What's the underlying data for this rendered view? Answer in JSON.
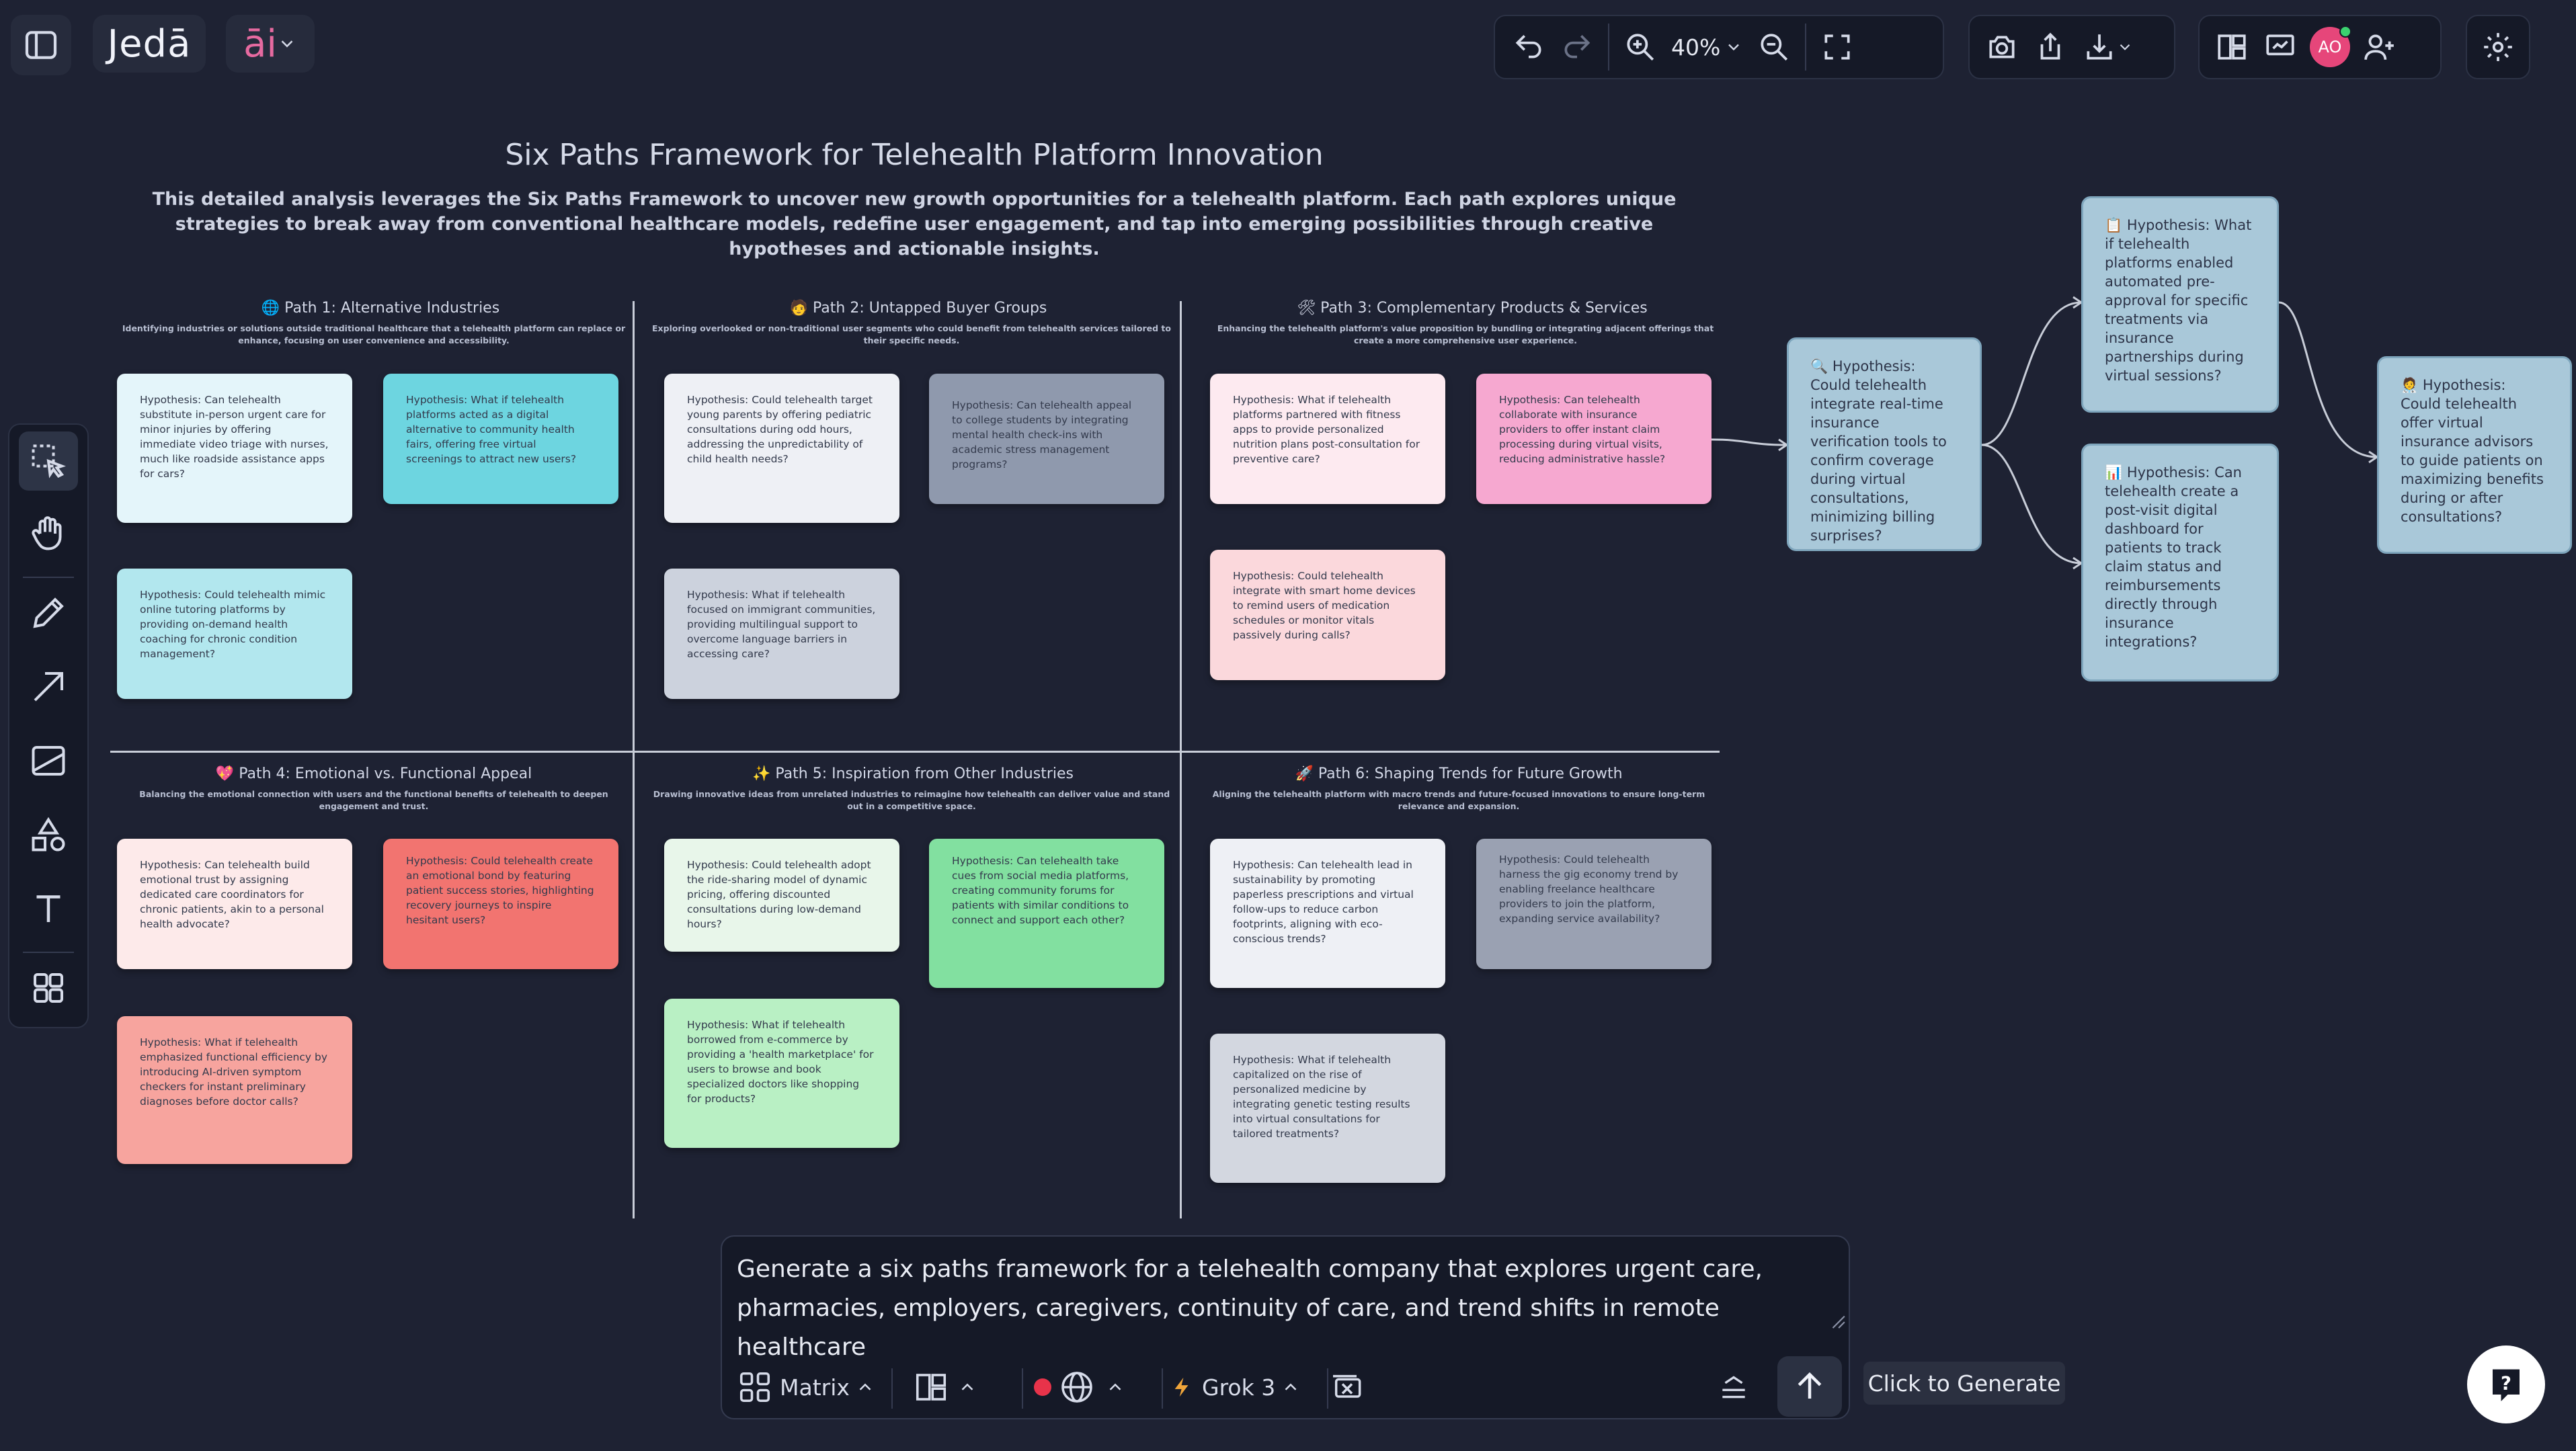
{
  "app": {
    "logo": "Jedā",
    "ai_label": "āi"
  },
  "toolbar": {
    "zoom": "40%",
    "avatar_initials": "AO"
  },
  "canvas": {
    "title": "Six Paths Framework for Telehealth Platform Innovation",
    "description": "This detailed analysis leverages the Six Paths Framework to uncover new growth opportunities for a telehealth platform. Each path explores unique strategies to break away from conventional healthcare models, redefine user engagement, and tap into emerging possibilities through creative hypotheses and actionable insights.",
    "paths": [
      {
        "title": "🌐 Path 1: Alternative Industries",
        "desc": "Identifying industries or solutions outside traditional healthcare that a telehealth platform can replace or enhance, focusing on user convenience and accessibility.",
        "cards": [
          "Hypothesis: Can telehealth substitute in-person urgent care for minor injuries by offering immediate video triage with nurses, much like roadside assistance apps for cars?",
          "Hypothesis: What if telehealth platforms acted as a digital alternative to community health fairs, offering free virtual screenings to attract new users?",
          "Hypothesis: Could telehealth mimic online tutoring platforms by providing on-demand health coaching for chronic condition management?"
        ]
      },
      {
        "title": "🧑 Path 2: Untapped Buyer Groups",
        "desc": "Exploring overlooked or non-traditional user segments who could benefit from telehealth services tailored to their specific needs.",
        "cards": [
          "Hypothesis: Could telehealth target young parents by offering pediatric consultations during odd hours, addressing the unpredictability of child health needs?",
          "Hypothesis: Can telehealth appeal to college students by integrating mental health check-ins with academic stress management programs?",
          "Hypothesis: What if telehealth focused on immigrant communities, providing multilingual support to overcome language barriers in accessing care?"
        ]
      },
      {
        "title": "🛠 Path 3: Complementary Products & Services",
        "desc": "Enhancing the telehealth platform's value proposition by bundling or integrating adjacent offerings that create a more comprehensive user experience.",
        "cards": [
          "Hypothesis: What if telehealth platforms partnered with fitness apps to provide personalized nutrition plans post-consultation for preventive care?",
          "Hypothesis: Can telehealth collaborate with insurance providers to offer instant claim processing during virtual visits, reducing administrative hassle?",
          "Hypothesis: Could telehealth integrate with smart home devices to remind users of medication schedules or monitor vitals passively during calls?"
        ]
      },
      {
        "title": "💖 Path 4: Emotional vs. Functional Appeal",
        "desc": "Balancing the emotional connection with users and the functional benefits of telehealth to deepen engagement and trust.",
        "cards": [
          "Hypothesis: Can telehealth build emotional trust by assigning dedicated care coordinators for chronic patients, akin to a personal health advocate?",
          "Hypothesis: Could telehealth create an emotional bond by featuring patient success stories, highlighting recovery journeys to inspire hesitant users?",
          "Hypothesis: What if telehealth emphasized functional efficiency by introducing AI-driven symptom checkers for instant preliminary diagnoses before doctor calls?"
        ]
      },
      {
        "title": "✨ Path 5: Inspiration from Other Industries",
        "desc": "Drawing innovative ideas from unrelated industries to reimagine how telehealth can deliver value and stand out in a competitive space.",
        "cards": [
          "Hypothesis: Could telehealth adopt the ride-sharing model of dynamic pricing, offering discounted consultations during low-demand hours?",
          "Hypothesis: Can telehealth take cues from social media platforms, creating community forums for patients with similar conditions to connect and support each other?",
          "Hypothesis: What if telehealth borrowed from e-commerce by providing a 'health marketplace' for users to browse and book specialized doctors like shopping for products?"
        ]
      },
      {
        "title": "🚀 Path 6: Shaping Trends for Future Growth",
        "desc": "Aligning the telehealth platform with macro trends and future-focused innovations to ensure long-term relevance and expansion.",
        "cards": [
          "Hypothesis: Can telehealth lead in sustainability by promoting paperless prescriptions and virtual follow-ups to reduce carbon footprints, aligning with eco-conscious trends?",
          "Hypothesis: Could telehealth harness the gig economy trend by enabling freelance healthcare providers to join the platform, expanding service availability?",
          "Hypothesis: What if telehealth capitalized on the rise of personalized medicine by integrating genetic testing results into virtual consultations for tailored treatments?"
        ]
      }
    ],
    "branch": {
      "root": "🔍 Hypothesis: Could telehealth integrate real-time insurance verification tools to confirm coverage during virtual consultations, minimizing billing surprises?",
      "top": "📋 Hypothesis: What if telehealth platforms enabled automated pre-approval for specific treatments via insurance partnerships during virtual sessions?",
      "bottom": "📊 Hypothesis: Can telehealth create a post-visit digital dashboard for patients to track claim status and reimbursements directly through insurance integrations?",
      "right": "🧑‍⚕️ Hypothesis: Could telehealth offer virtual insurance advisors to guide patients on maximizing benefits during or after consultations?"
    }
  },
  "prompt": {
    "text": "Generate a six paths framework for a telehealth company that explores urgent care, pharmacies, employers, caregivers, continuity of care, and trend shifts in remote healthcare",
    "layout_label": "Matrix",
    "model_label": "Grok 3",
    "tooltip": "Click to Generate"
  }
}
